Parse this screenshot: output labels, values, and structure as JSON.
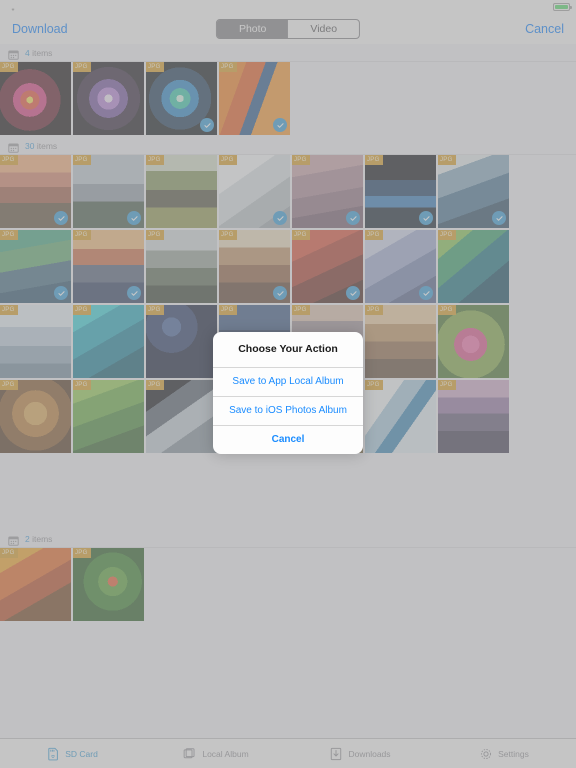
{
  "statusbar": {
    "carrier": "",
    "time": "",
    "battery_color": "#4cd964"
  },
  "navbar": {
    "left_button": "Download",
    "right_button": "Cancel",
    "segments": [
      {
        "label": "Photo",
        "selected": true
      },
      {
        "label": "Video",
        "selected": false
      }
    ]
  },
  "sections": [
    {
      "count": "4",
      "unit": "items",
      "icon": "calendar-icon"
    },
    {
      "count": "30",
      "unit": "items",
      "icon": "calendar-icon"
    },
    {
      "count": "2",
      "unit": "items",
      "icon": "calendar-icon"
    }
  ],
  "thumbnail": {
    "badge": "JPG",
    "badge_color": "#d79a1e",
    "check_color": "#2b96d4"
  },
  "dialog": {
    "title": "Choose Your Action",
    "actions": [
      {
        "label": "Save to App Local Album",
        "bold": false
      },
      {
        "label": "Save to iOS Photos Album",
        "bold": false
      },
      {
        "label": "Cancel",
        "bold": true
      }
    ]
  },
  "tabbar": {
    "tabs": [
      {
        "label": "SD Card",
        "icon": "sd-card-icon",
        "selected": true
      },
      {
        "label": "Local Album",
        "icon": "stacked-photos-icon",
        "selected": false
      },
      {
        "label": "Downloads",
        "icon": "download-arrow-icon",
        "selected": false
      },
      {
        "label": "Settings",
        "icon": "gear-icon",
        "selected": false
      }
    ]
  },
  "grid": {
    "section1": [
      {
        "selected": false,
        "art": "explosion-red"
      },
      {
        "selected": false,
        "art": "explosion-violet"
      },
      {
        "selected": true,
        "art": "explosion-teal"
      },
      {
        "selected": true,
        "art": "waves-orange"
      }
    ],
    "section2": [
      {
        "selected": true,
        "art": "canyon-dawn"
      },
      {
        "selected": true,
        "art": "yosemite-granite"
      },
      {
        "selected": false,
        "art": "elephant-savanna"
      },
      {
        "selected": true,
        "art": "white-dunes"
      },
      {
        "selected": true,
        "art": "mauve-sand"
      },
      {
        "selected": true,
        "art": "earth-moon"
      },
      {
        "selected": true,
        "art": "blue-wave"
      },
      {
        "selected": true,
        "art": "green-grass-mac"
      },
      {
        "selected": true,
        "art": "elcap-sunrise"
      },
      {
        "selected": false,
        "art": "misty-forest"
      },
      {
        "selected": true,
        "art": "rock-arch"
      },
      {
        "selected": true,
        "art": "red-canyon"
      },
      {
        "selected": true,
        "art": "blue-ridge-aerial"
      },
      {
        "selected": false,
        "art": "green-island"
      },
      {
        "selected": false,
        "art": "ice-forest"
      },
      {
        "selected": false,
        "art": "teal-currents"
      },
      {
        "selected": false,
        "art": "starry-night"
      },
      {
        "selected": false,
        "art": "night-mountain"
      },
      {
        "selected": false,
        "art": "lake-reflection"
      },
      {
        "selected": false,
        "art": "desert-mesa"
      },
      {
        "selected": false,
        "art": "pink-poppies"
      },
      {
        "selected": false,
        "art": "lion-portrait"
      },
      {
        "selected": false,
        "art": "green-fields"
      },
      {
        "selected": false,
        "art": "earth-limb"
      },
      {
        "selected": false,
        "art": "pink-wheat"
      },
      {
        "selected": false,
        "art": "golden-grass"
      },
      {
        "selected": false,
        "art": "frozen-river"
      },
      {
        "selected": false,
        "art": "purple-lake"
      },
      {
        "selected": false,
        "art": "blank-a"
      },
      {
        "selected": false,
        "art": "blank-b"
      }
    ],
    "section3": [
      {
        "selected": false,
        "art": "orange-abstract"
      },
      {
        "selected": false,
        "art": "tree-frog"
      }
    ]
  }
}
